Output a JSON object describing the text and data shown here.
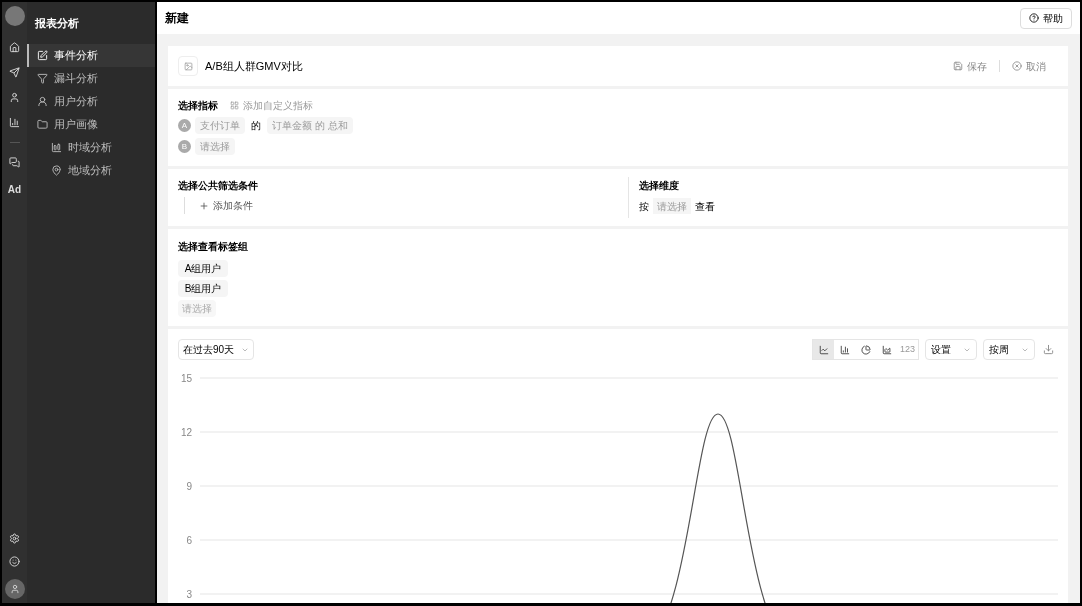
{
  "rail": {
    "ad_label": "Ad"
  },
  "sidebar": {
    "title": "报表分析",
    "items": [
      {
        "label": "事件分析",
        "selected": true
      },
      {
        "label": "漏斗分析",
        "selected": false
      },
      {
        "label": "用户分析",
        "selected": false
      },
      {
        "label": "用户画像",
        "selected": false,
        "children": [
          {
            "label": "时域分析",
            "selected": false
          },
          {
            "label": "地域分析",
            "selected": false
          }
        ]
      }
    ]
  },
  "header": {
    "title": "新建",
    "help_button": "帮助"
  },
  "report": {
    "title": "A/B组人群GMV对比",
    "save": "保存",
    "cancel": "取消"
  },
  "metrics": {
    "title": "选择指标",
    "add_custom": "添加自定义指标",
    "rows": [
      {
        "badge": "A",
        "parts": [
          {
            "kind": "chip",
            "text": "支付订单"
          },
          {
            "kind": "word",
            "text": "的"
          },
          {
            "kind": "chip",
            "text": "订单金额 的 总和"
          }
        ]
      },
      {
        "badge": "B",
        "parts": [
          {
            "kind": "chip",
            "text": "请选择"
          }
        ]
      }
    ]
  },
  "filters": {
    "title": "选择公共筛选条件",
    "add": "添加条件"
  },
  "dimension": {
    "title": "选择维度",
    "prefix": "按",
    "select": "请选择",
    "suffix": "查看"
  },
  "tag_groups": {
    "title": "选择查看标签组",
    "tags": [
      {
        "kind": "tag",
        "text": "A组用户"
      },
      {
        "kind": "tag",
        "text": "B组用户"
      },
      {
        "kind": "placeholder",
        "text": "请选择"
      }
    ]
  },
  "chart_toolbar": {
    "range": "在过去90天",
    "chart_types": [
      {
        "kind": "line",
        "selected": true,
        "disabled": false
      },
      {
        "kind": "bar",
        "selected": false,
        "disabled": false
      },
      {
        "kind": "pie",
        "selected": false,
        "disabled": false
      },
      {
        "kind": "area",
        "selected": false,
        "disabled": false
      },
      {
        "kind": "number",
        "label": "123",
        "selected": false,
        "disabled": true
      }
    ],
    "settings": "设置",
    "interval": "按周"
  },
  "chart": {
    "y_ticks": [
      "15",
      "12",
      "9",
      "6",
      "3"
    ]
  }
}
